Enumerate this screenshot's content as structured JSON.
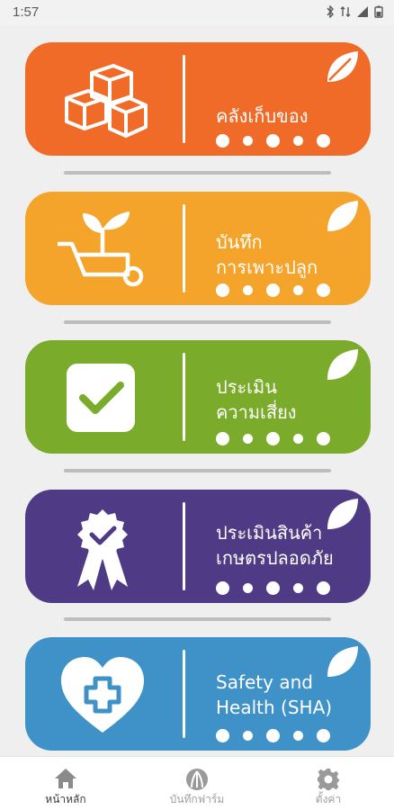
{
  "status_bar": {
    "time": "1:57"
  },
  "cards": [
    {
      "title_lines": [
        "คลังเก็บของ"
      ],
      "color": "#f06a28",
      "icon": "boxes-icon"
    },
    {
      "title_lines": [
        "บันทึก",
        "การเพาะปลูก"
      ],
      "color": "#f5a42b",
      "icon": "wheelbarrow-sprout-icon"
    },
    {
      "title_lines": [
        "ประเมิน",
        "ความเสี่ยง"
      ],
      "color": "#7aab2a",
      "icon": "checkbox-icon"
    },
    {
      "title_lines": [
        "ประเมินสินค้า",
        "เกษตรปลอดภัย"
      ],
      "color": "#4f3a86",
      "icon": "ribbon-badge-icon"
    },
    {
      "title_lines": [
        "Safety and",
        "Health (SHA)"
      ],
      "color": "#3f92c8",
      "icon": "heart-cross-icon"
    }
  ],
  "bottom_nav": [
    {
      "label": "หน้าหลัก",
      "icon": "home-icon",
      "active": true
    },
    {
      "label": "บันทึกฟาร์ม",
      "icon": "farm-record-icon",
      "active": false
    },
    {
      "label": "ตั้งค่า",
      "icon": "gear-icon",
      "active": false
    }
  ]
}
